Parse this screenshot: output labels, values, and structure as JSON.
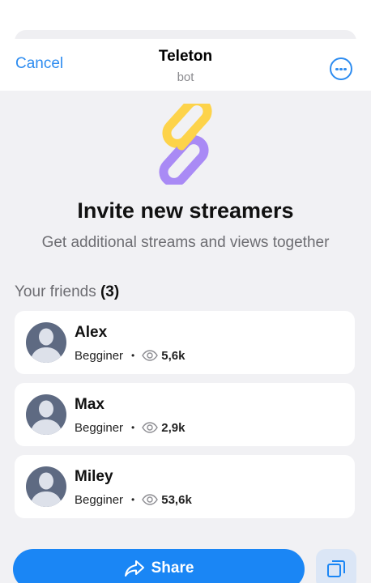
{
  "header": {
    "cancel_label": "Cancel",
    "title": "Teleton",
    "subtitle": "bot",
    "more_icon": "more-horizontal-icon"
  },
  "hero": {
    "icon": "link-chain-icon",
    "title": "Invite new streamers",
    "subtitle": "Get additional streams and views together"
  },
  "friends": {
    "heading": "Your friends",
    "count": "(3)",
    "items": [
      {
        "name": "Alex",
        "level": "Begginer",
        "separator": "•",
        "views": "5,6k"
      },
      {
        "name": "Max",
        "level": "Begginer",
        "separator": "•",
        "views": "2,9k"
      },
      {
        "name": "Miley",
        "level": "Begginer",
        "separator": "•",
        "views": "53,6k"
      }
    ]
  },
  "actions": {
    "share_label": "Share",
    "share_icon": "share-arrow-icon",
    "copy_icon": "copy-icon"
  },
  "colors": {
    "accent": "#1a86f5",
    "link": "#2d8cf0",
    "background": "#f1f1f4",
    "avatar": "#5e6a82",
    "chain_yellow": "#fdd34a",
    "chain_purple": "#a98af5"
  }
}
